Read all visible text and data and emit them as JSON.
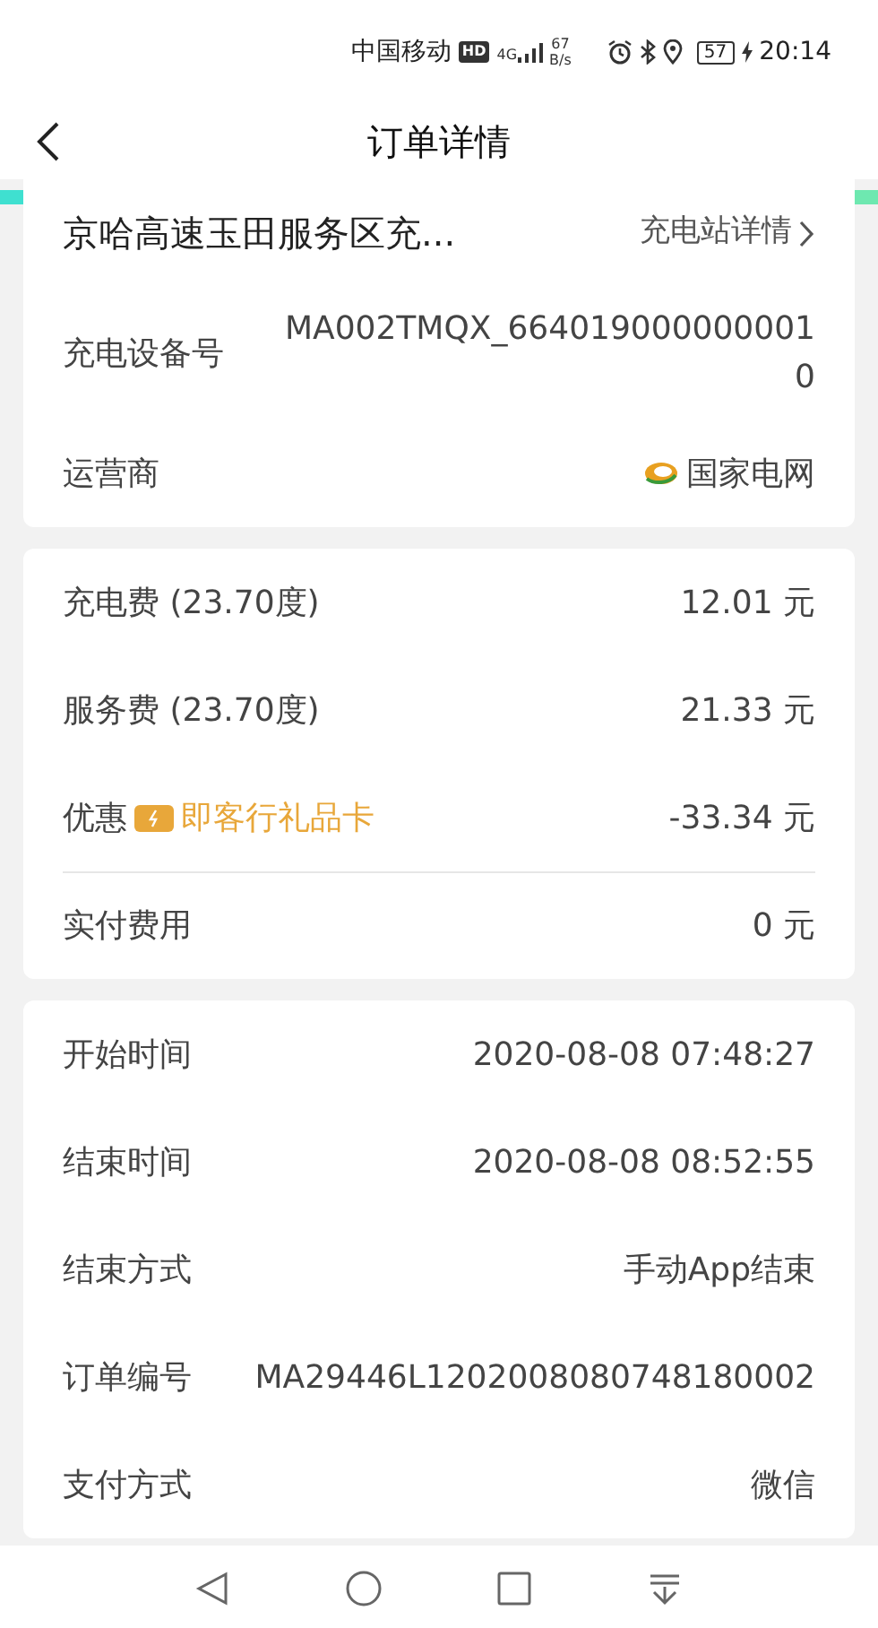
{
  "status_bar": {
    "carrier": "中国移动",
    "hd": "HD",
    "network": "4G",
    "speed_value": "67",
    "speed_unit": "B/s",
    "battery": "57",
    "time": "20:14"
  },
  "header": {
    "title": "订单详情"
  },
  "cards": [
    {
      "rows": [
        {
          "kind": "station",
          "label": "京哈高速玉田服务区充...",
          "value": "充电站详情"
        },
        {
          "kind": "field",
          "label": "充电设备号",
          "value": "MA002TMQX_6640190000000010"
        },
        {
          "kind": "operator",
          "label": "运营商",
          "value": "国家电网"
        }
      ]
    },
    {
      "rows": [
        {
          "kind": "field",
          "label": "充电费 (23.70度)",
          "value": "12.01 元"
        },
        {
          "kind": "field",
          "label": "服务费 (23.70度)",
          "value": "21.33 元"
        },
        {
          "kind": "discount",
          "label": "优惠",
          "tag": "即客行礼品卡",
          "value": "-33.34 元"
        },
        {
          "kind": "field",
          "label": "实付费用",
          "value": "0 元",
          "separated": true
        }
      ]
    },
    {
      "rows": [
        {
          "kind": "field",
          "label": "开始时间",
          "value": "2020-08-08 07:48:27"
        },
        {
          "kind": "field",
          "label": "结束时间",
          "value": "2020-08-08 08:52:55"
        },
        {
          "kind": "field",
          "label": "结束方式",
          "value": "手动App结束"
        },
        {
          "kind": "inline",
          "label": "订单编号",
          "value": "MA29446L1202008080748180002"
        },
        {
          "kind": "field",
          "label": "支付方式",
          "value": "微信"
        }
      ]
    }
  ]
}
